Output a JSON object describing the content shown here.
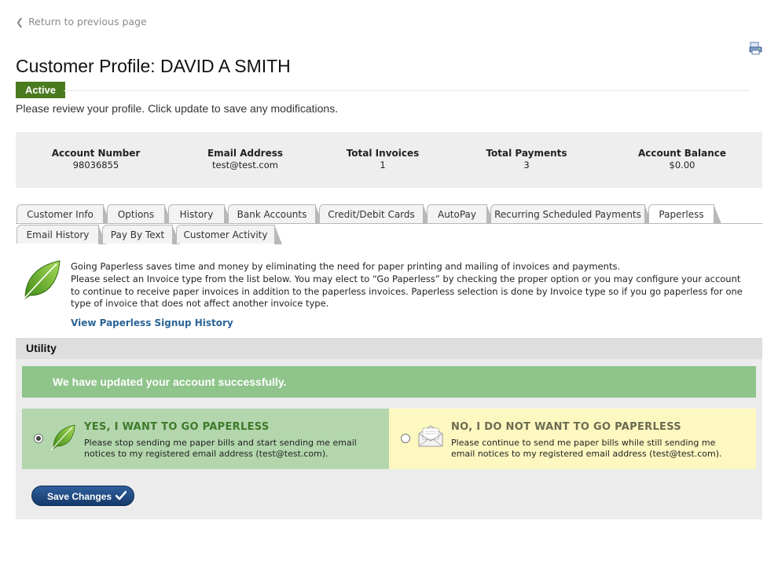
{
  "nav": {
    "back_label": "Return to previous page"
  },
  "header": {
    "title": "Customer Profile: DAVID A SMITH",
    "status": "Active",
    "intro": "Please review your profile. Click update to save any modifications."
  },
  "summary": [
    {
      "label": "Account Number",
      "value": "98036855"
    },
    {
      "label": "Email Address",
      "value": "test@test.com"
    },
    {
      "label": "Total Invoices",
      "value": "1"
    },
    {
      "label": "Total Payments",
      "value": "3"
    },
    {
      "label": "Account Balance",
      "value": "$0.00"
    }
  ],
  "tabs": {
    "row1": [
      "Customer Info",
      "Options",
      "History",
      "Bank Accounts",
      "Credit/Debit Cards",
      "AutoPay",
      "Recurring Scheduled Payments",
      "Paperless"
    ],
    "row2": [
      "Email History",
      "Pay By Text",
      "Customer Activity"
    ],
    "active": "Paperless"
  },
  "paperless": {
    "line1": "Going Paperless saves time and money by eliminating the need for paper printing and mailing of invoices and payments.",
    "line2": "Please select an Invoice type from the list below. You may elect to “Go Paperless” by checking the proper option or you may configure your account to continue to receive paper invoices in addition to the paperless invoices. Paperless selection is done by Invoice type so if you go paperless for one type of invoice that does not affect another invoice type.",
    "history_link": "View Paperless Signup History"
  },
  "utility": {
    "heading": "Utility",
    "success_message": "We have updated your account successfully.",
    "option_yes": {
      "title": "YES, I WANT TO GO PAPERLESS",
      "description": "Please stop sending me paper bills and start sending me email notices to my registered email address (test@test.com).",
      "selected": true
    },
    "option_no": {
      "title": "NO, I DO NOT WANT TO GO PAPERLESS",
      "description": "Please continue to send me paper bills while still sending me email notices to my registered email address (test@test.com).",
      "selected": false
    },
    "save_label": "Save Changes"
  },
  "colors": {
    "status_badge": "#4a7a1e",
    "success_banner": "#8fc48b",
    "yes_panel": "#b3d6ad",
    "no_panel": "#fdf8c0",
    "link": "#2a6496",
    "save_button": "#1f4a80"
  },
  "icons": [
    "chevron-left-icon",
    "print-icon",
    "leaf-icon",
    "envelope-icon",
    "checkmark-icon"
  ]
}
